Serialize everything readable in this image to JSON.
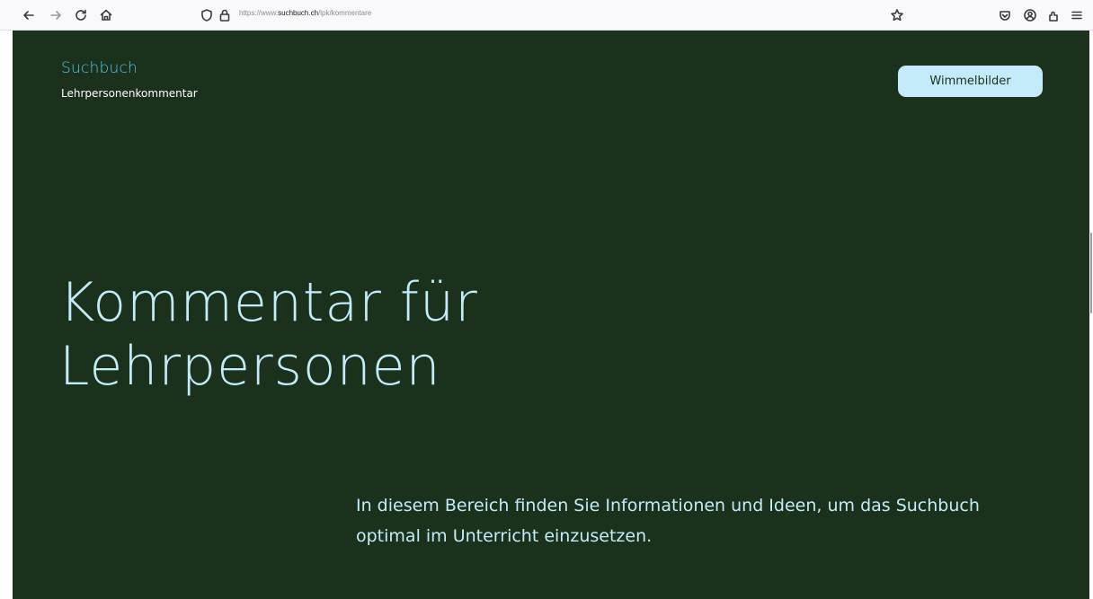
{
  "browser": {
    "url_prefix": "https://www.",
    "url_domain": "suchbuch.ch",
    "url_path": "/lpk/kommentare"
  },
  "icons": {
    "back": "arrow-left-icon",
    "forward": "arrow-right-icon",
    "reload": "reload-icon",
    "home": "home-icon",
    "shield": "shield-icon",
    "lock": "lock-icon",
    "bookmark": "star-icon",
    "pocket": "pocket-icon",
    "account": "account-icon",
    "extensions": "extensions-icon",
    "menu": "hamburger-menu-icon"
  },
  "site": {
    "brand": "Suchbuch",
    "subbrand": "Lehrpersonenkommentar",
    "nav_button": "Wimmelbilder"
  },
  "hero": {
    "title_line1": "Kommentar für",
    "title_line2": "Lehrpersonen",
    "intro": "In diesem Bereich finden Sie Informationen und Ideen, um das Suchbuch optimal im Unterricht einzusetzen."
  },
  "colors": {
    "background": "#1b311c",
    "accent": "#c4ebf9",
    "brand": "#52c6ea"
  }
}
